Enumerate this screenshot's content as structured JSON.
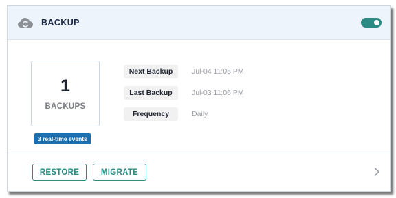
{
  "card": {
    "title": "BACKUP",
    "icon": "cloud-sync-icon",
    "toggle": {
      "on": true,
      "color": "#2a8a84"
    }
  },
  "summary": {
    "count": "1",
    "count_label": "BACKUPS",
    "events_badge": "3 real-time events",
    "badge_color": "#1b6fae"
  },
  "details": [
    {
      "label": "Next Backup",
      "value": "Jul-04 11:05 PM"
    },
    {
      "label": "Last Backup",
      "value": "Jul-03 11:06 PM"
    },
    {
      "label": "Frequency",
      "value": "Daily"
    }
  ],
  "actions": {
    "restore": "RESTORE",
    "migrate": "MIGRATE",
    "more_icon": "chevron-right-icon"
  }
}
